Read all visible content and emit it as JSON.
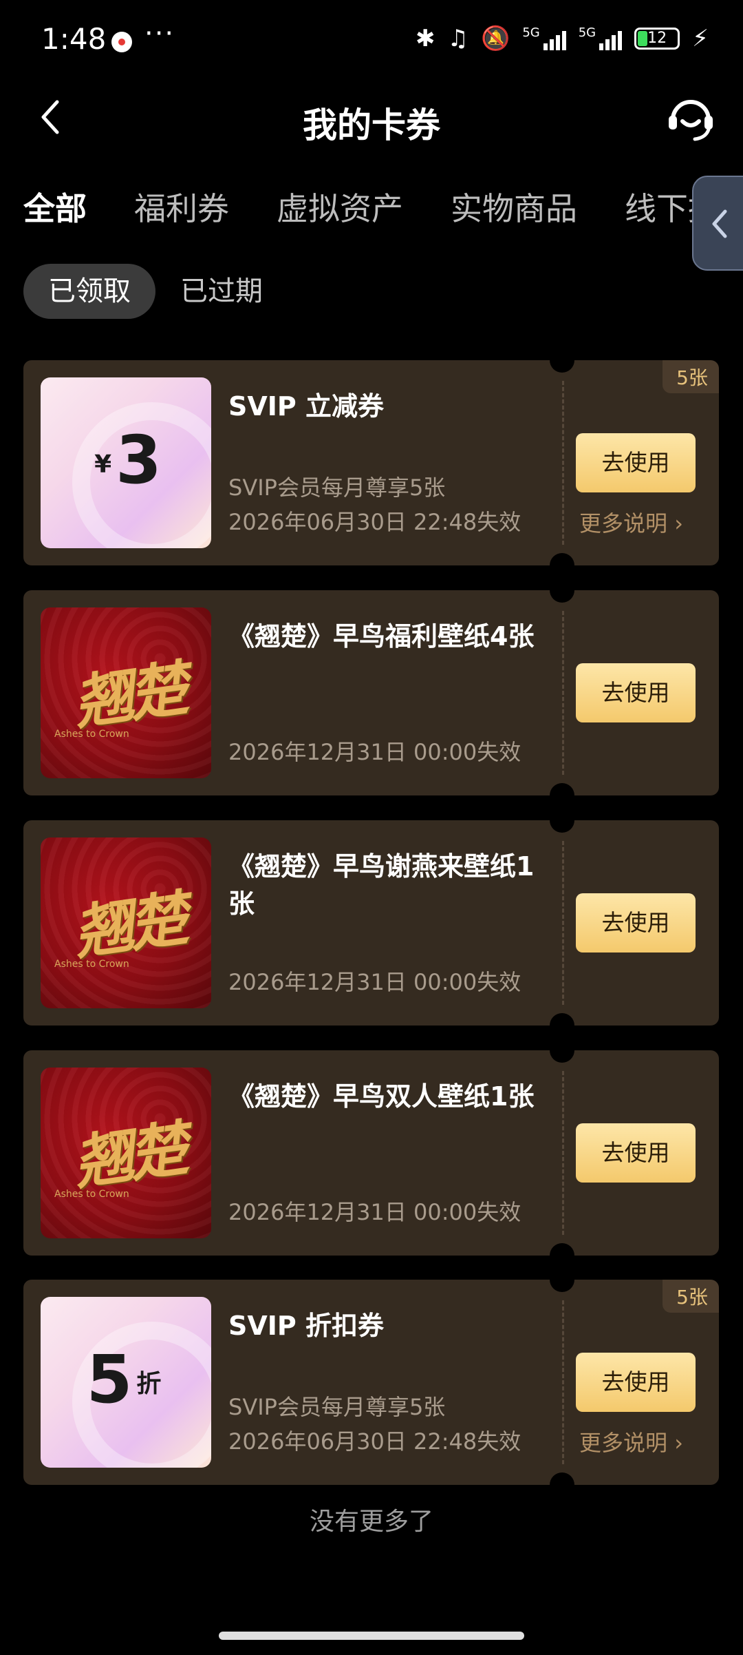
{
  "status_bar": {
    "time": "1:48",
    "more": "···",
    "net_5g": "5G",
    "battery": "12"
  },
  "header": {
    "title": "我的卡券"
  },
  "tabs": [
    "全部",
    "福利券",
    "虚拟资产",
    "实物商品",
    "线下报名"
  ],
  "filters": [
    "已领取",
    "已过期"
  ],
  "cards": [
    {
      "type": "coupon",
      "currency": "¥",
      "value": "3",
      "title": "SVIP 立减券",
      "desc": "SVIP会员每月尊享5张",
      "expiry": "2026年06月30日 22:48失效",
      "button": "去使用",
      "more": "更多说明",
      "badge": "5张"
    },
    {
      "type": "wallpaper",
      "art_text": "翘楚",
      "art_sub": "Ashes to Crown",
      "title": "《翘楚》早鸟福利壁纸4张",
      "expiry": "2026年12月31日 00:00失效",
      "button": "去使用"
    },
    {
      "type": "wallpaper",
      "art_text": "翘楚",
      "art_sub": "Ashes to Crown",
      "title": "《翘楚》早鸟谢燕来壁纸1张",
      "expiry": "2026年12月31日 00:00失效",
      "button": "去使用"
    },
    {
      "type": "wallpaper",
      "art_text": "翘楚",
      "art_sub": "Ashes to Crown",
      "title": "《翘楚》早鸟双人壁纸1张",
      "expiry": "2026年12月31日 00:00失效",
      "button": "去使用"
    },
    {
      "type": "coupon",
      "value": "5",
      "unit": "折",
      "title": "SVIP 折扣券",
      "desc": "SVIP会员每月尊享5张",
      "expiry": "2026年06月30日 22:48失效",
      "button": "去使用",
      "more": "更多说明",
      "badge": "5张"
    }
  ],
  "footer": {
    "end_text": "没有更多了"
  },
  "colors": {
    "card_bg": "#352b20",
    "button_gold": "#f4c96c",
    "badge_text": "#e7c27c"
  }
}
